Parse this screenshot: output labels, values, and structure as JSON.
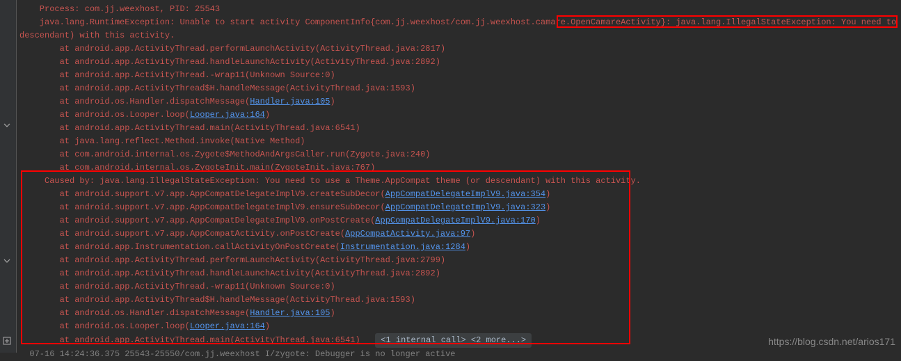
{
  "process_line": "    Process: com.jj.weexhost, PID: 25543",
  "exception_line_p1": "    java.lang.RuntimeException: Unable to start activity ComponentInfo{com.jj.weexhost/com.jj.weexhost.camare.OpenCamareActivity}: ",
  "exception_line_p2": "java.lang.IllegalStateException: You need to use a Theme.AppCompat theme (or",
  "exception_line2": "descendant) with this activity.",
  "stack1": [
    "        at android.app.ActivityThread.performLaunchActivity(ActivityThread.java:2817)",
    "        at android.app.ActivityThread.handleLaunchActivity(ActivityThread.java:2892)",
    "        at android.app.ActivityThread.-wrap11(Unknown Source:0)",
    "        at android.app.ActivityThread$H.handleMessage(ActivityThread.java:1593)"
  ],
  "stack_handler1_pre": "        at android.os.Handler.dispatchMessage(",
  "stack_handler1_link": "Handler.java:105",
  "stack_handler1_post": ")",
  "stack_looper1_pre": "        at android.os.Looper.loop(",
  "stack_looper1_link": "Looper.java:164",
  "stack_looper1_post": ")",
  "stack2": [
    "        at android.app.ActivityThread.main(ActivityThread.java:6541)",
    "        at java.lang.reflect.Method.invoke(Native Method)",
    "        at com.android.internal.os.Zygote$MethodAndArgsCaller.run(Zygote.java:240)",
    "        at com.android.internal.os.ZygoteInit.main(ZygoteInit.java:767)"
  ],
  "caused_by": "     Caused by: java.lang.IllegalStateException: You need to use a Theme.AppCompat theme (or descendant) with this activity.",
  "cb1_pre": "        at android.support.v7.app.AppCompatDelegateImplV9.createSubDecor(",
  "cb1_link": "AppCompatDelegateImplV9.java:354",
  "cb1_post": ")",
  "cb2_pre": "        at android.support.v7.app.AppCompatDelegateImplV9.ensureSubDecor(",
  "cb2_link": "AppCompatDelegateImplV9.java:323",
  "cb2_post": ")",
  "cb3_pre": "        at android.support.v7.app.AppCompatDelegateImplV9.onPostCreate(",
  "cb3_link": "AppCompatDelegateImplV9.java:170",
  "cb3_post": ")",
  "cb4_pre": "        at android.support.v7.app.AppCompatActivity.onPostCreate(",
  "cb4_link": "AppCompatActivity.java:97",
  "cb4_post": ")",
  "cb5_pre": "        at android.app.Instrumentation.callActivityOnPostCreate(",
  "cb5_link": "Instrumentation.java:1284",
  "cb5_post": ")",
  "stack3": [
    "        at android.app.ActivityThread.performLaunchActivity(ActivityThread.java:2799)",
    "        at android.app.ActivityThread.handleLaunchActivity(ActivityThread.java:2892)",
    "        at android.app.ActivityThread.-wrap11(Unknown Source:0)",
    "        at android.app.ActivityThread$H.handleMessage(ActivityThread.java:1593)"
  ],
  "stack_handler2_pre": "        at android.os.Handler.dispatchMessage(",
  "stack_handler2_link": "Handler.java:105",
  "stack_handler2_post": ")",
  "stack_looper2_pre": "        at android.os.Looper.loop(",
  "stack_looper2_link": "Looper.java:164",
  "stack_looper2_post": ")",
  "last_pre": "        at android.app.ActivityThread.main(ActivityThread.java:6541)   ",
  "more_pill": "<1 internal call> <2 more...>",
  "bottom_gray": "  07-16 14:24:36.375 25543-25550/com.jj.weexhost I/zygote: Debugger is no longer active",
  "watermark": "https://blog.csdn.net/arios171"
}
